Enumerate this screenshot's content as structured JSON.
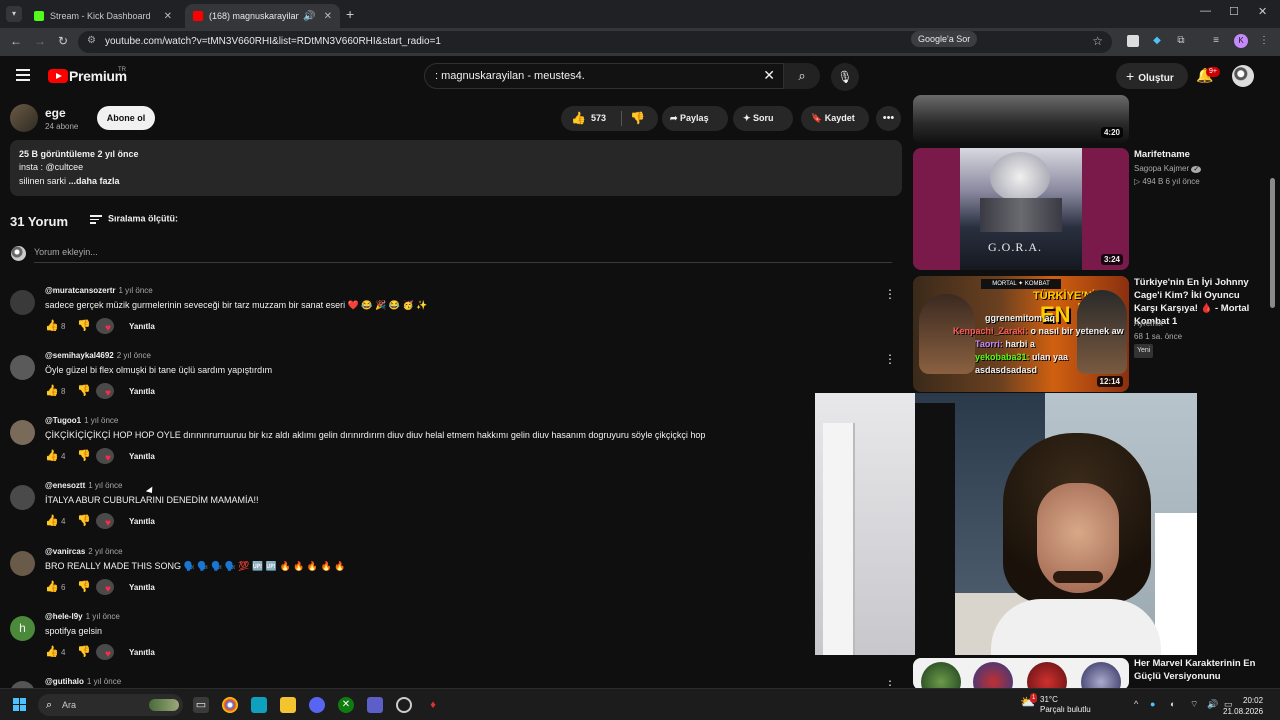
{
  "browser": {
    "tabs": [
      {
        "title": "Stream - Kick Dashboard",
        "active": false
      },
      {
        "title": "(168) magnuskarayilan - me",
        "active": true
      }
    ],
    "url": "youtube.com/watch?v=tMN3V660RHI&list=RDtMN3V660RHI&start_radio=1",
    "google_sor": "Google'a Sor",
    "profile_letter": "K"
  },
  "header": {
    "brand": "Premium",
    "brand_region": "TR",
    "search_value": ": magnuskarayilan - meustes4.",
    "create_label": "Oluştur",
    "notif_badge": "9+"
  },
  "channel": {
    "name": "ege",
    "subs": "24 abone",
    "subscribe_label": "Abone ol",
    "likes": "573",
    "share_label": "Paylaş",
    "ask_label": "Soru",
    "save_label": "Kaydet"
  },
  "description": {
    "stats": "25 B görüntüleme  2 yıl önce",
    "line2": "insta : @cultcee",
    "line3_text": "silinen sarki ",
    "line3_more": "...daha fazla"
  },
  "comments_header": {
    "count": "31 Yorum",
    "sort_label": "Sıralama ölçütü:",
    "add_placeholder": "Yorum ekleyin..."
  },
  "comments": [
    {
      "handle": "@muratcansozertr",
      "time": "1 yıl önce",
      "text": "sadece gerçek müzik gurmelerinin seveceği bir tarz muzzam bir sanat eseri ❤️ 😂 🎉 😂 🥳 ✨",
      "likes": "8",
      "avatar_color": "#3a3a3a"
    },
    {
      "handle": "@semihaykal4692",
      "time": "2 yıl önce",
      "text": "Öyle güzel bi flex olmuşki bi tane üçlü sardım yapıştırdım",
      "likes": "8",
      "avatar_color": "#5a5a5a"
    },
    {
      "handle": "@Tugoo1",
      "time": "1 yıl önce",
      "text": "ÇİKÇİKİÇİÇİKÇİ HOP HOP OYLE dırınırırurruuruu bir kız aldı aklımı gelin dırınırdırırn diuv diuv helal etmem hakkımı gelin diuv hasanım dogruyuru söyle çikçiçkçi hop",
      "likes": "4",
      "avatar_color": "#7a6a5a"
    },
    {
      "handle": "@enesoztt",
      "time": "1 yıl önce",
      "text": "İTALYA ABUR CUBURLARINI DENEDİM MAMAMİA!!",
      "likes": "4",
      "avatar_color": "#4a4a4a"
    },
    {
      "handle": "@vanircas",
      "time": "2 yıl önce",
      "text": "BRO REALLY MADE THIS SONG 🗣️ 🗣️ 🗣️ 🗣️ 💯 🆙 🆙 🔥 🔥 🔥 🔥 🔥",
      "likes": "6",
      "avatar_color": "#6a5a4a"
    },
    {
      "handle": "@hele-l9y",
      "time": "1 yıl önce",
      "text": "spotifya gelsin",
      "likes": "4",
      "avatar_color": "#4a8a3a",
      "avatar_letter": "h"
    },
    {
      "handle": "@gutihalo",
      "time": "1 yıl önce",
      "text": "",
      "likes": "",
      "avatar_color": "#555555"
    }
  ],
  "reply_label": "Yanıtla",
  "related": [
    {
      "title": "",
      "channel": "",
      "meta": "",
      "duration": "4:20"
    },
    {
      "title": "Marifetname",
      "channel": "Sagopa Kajmer",
      "meta": "▷ 494 B   6 yıl önce",
      "duration": "3:24"
    },
    {
      "title": "Türkiye'nin En İyi Johnny Cage'i Kim? İki Oyuncu Karşı Karşıya! 🩸 - Mortal Kombat 1",
      "channel": "Ayremix",
      "meta": "68   1 sa. önce",
      "badge": "Yeni",
      "duration": "12:14"
    },
    {
      "title": "Her Marvel Karakterinin En Güçlü Versiyonunu",
      "channel": "",
      "meta": "",
      "duration": ""
    }
  ],
  "chat_overlay": [
    {
      "user": "",
      "msg": "ggrenemitom aq"
    },
    {
      "user": "Kenpachi_Zaraki:",
      "msg": "o nasıl bir yetenek aw"
    },
    {
      "user": "Taorri:",
      "msg": "harbi a"
    },
    {
      "user": "yekobaba31:",
      "msg": "ulan yaa asdasdsadasd"
    }
  ],
  "taskbar": {
    "search_placeholder": "Ara",
    "weather_temp": "31°C",
    "weather_desc": "Parçalı bulutlu",
    "weather_badge": "1",
    "time": "20:02",
    "date": "21.08.2026"
  },
  "colors": {
    "youtube_red": "#ff0000",
    "kick_green": "#53fc18",
    "background": "#0f0f0f"
  }
}
